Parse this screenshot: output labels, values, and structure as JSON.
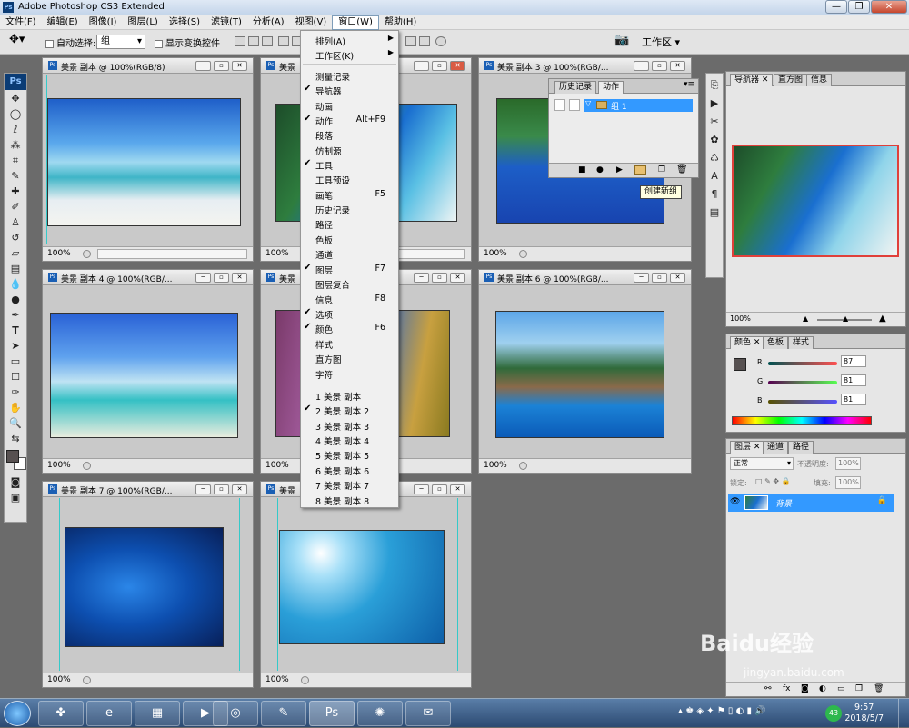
{
  "app": {
    "title": "Adobe Photoshop CS3 Extended",
    "logo": "Ps"
  },
  "window_buttons": {
    "minimize": "—",
    "restore": "❐",
    "close": "✕"
  },
  "menubar": [
    "文件(F)",
    "编辑(E)",
    "图像(I)",
    "图层(L)",
    "选择(S)",
    "滤镜(T)",
    "分析(A)",
    "视图(V)",
    "窗口(W)",
    "帮助(H)"
  ],
  "options": {
    "auto_select_label": "自动选择:",
    "auto_select_value": "组",
    "show_transform_label": "显示变换控件",
    "workspace_label": "工作区 ▾"
  },
  "documents": [
    {
      "title": "美景  副本 @ 100%(RGB/8)",
      "zoom": "100%"
    },
    {
      "title": "美景",
      "zoom": "100%"
    },
    {
      "title": "美景  副本 3 @ 100%(RGB/...",
      "zoom": "100%"
    },
    {
      "title": "美景  副本 4 @ 100%(RGB/...",
      "zoom": "100%"
    },
    {
      "title": "美景",
      "zoom": "100%"
    },
    {
      "title": "美景  副本 6 @ 100%(RGB/...",
      "zoom": "100%"
    },
    {
      "title": "美景  副本 7 @ 100%(RGB/...",
      "zoom": "100%"
    },
    {
      "title": "美景",
      "zoom": "100%"
    }
  ],
  "window_menu": {
    "items": [
      {
        "label": "排列(A)",
        "submenu": true
      },
      {
        "label": "工作区(K)",
        "submenu": true
      },
      {
        "label": "测量记录"
      },
      {
        "label": "导航器",
        "checked": true
      },
      {
        "label": "动画"
      },
      {
        "label": "动作",
        "checked": true,
        "shortcut": "Alt+F9"
      },
      {
        "label": "段落"
      },
      {
        "label": "仿制源"
      },
      {
        "label": "工具",
        "checked": true
      },
      {
        "label": "工具预设"
      },
      {
        "label": "画笔",
        "shortcut": "F5"
      },
      {
        "label": "历史记录"
      },
      {
        "label": "路径"
      },
      {
        "label": "色板"
      },
      {
        "label": "通道"
      },
      {
        "label": "图层",
        "checked": true,
        "shortcut": "F7"
      },
      {
        "label": "图层复合"
      },
      {
        "label": "信息",
        "shortcut": "F8"
      },
      {
        "label": "选项",
        "checked": true
      },
      {
        "label": "颜色",
        "checked": true,
        "shortcut": "F6"
      },
      {
        "label": "样式"
      },
      {
        "label": "直方图"
      },
      {
        "label": "字符"
      },
      {
        "label": "1 美景  副本"
      },
      {
        "label": "2 美景  副本 2",
        "checked": true
      },
      {
        "label": "3 美景  副本 3"
      },
      {
        "label": "4 美景  副本 4"
      },
      {
        "label": "5 美景  副本 5"
      },
      {
        "label": "6 美景  副本 6"
      },
      {
        "label": "7 美景  副本 7"
      },
      {
        "label": "8 美景  副本 8"
      }
    ],
    "checkmark": "✔",
    "arrow": "▶"
  },
  "actions_panel": {
    "tabs": [
      "历史记录",
      "动作"
    ],
    "group_name": "组 1",
    "tooltip": "创建新组"
  },
  "navigator_panel": {
    "tabs": [
      "导航器",
      "直方图",
      "信息"
    ],
    "zoom": "100%"
  },
  "color_panel": {
    "tabs": [
      "颜色",
      "色板",
      "样式"
    ],
    "r_label": "R",
    "g_label": "G",
    "b_label": "B",
    "r_value": "87",
    "g_value": "81",
    "b_value": "81"
  },
  "layers_panel": {
    "tabs": [
      "图层",
      "通道",
      "路径"
    ],
    "blend_mode": "正常",
    "opacity_label": "不透明度:",
    "opacity_value": "100%",
    "lock_label": "锁定:",
    "fill_label": "填充:",
    "fill_value": "100%",
    "layer_name": "背景"
  },
  "taskbar": {
    "time": "9:57",
    "date": "2018/5/7",
    "badge": "43"
  },
  "watermark": {
    "brand": "Baidu经验",
    "url": "jingyan.baidu.com"
  },
  "colors": {
    "highlight": "#3399ff",
    "navigator_frame": "#e0403a",
    "guide": "#35c9c9"
  }
}
